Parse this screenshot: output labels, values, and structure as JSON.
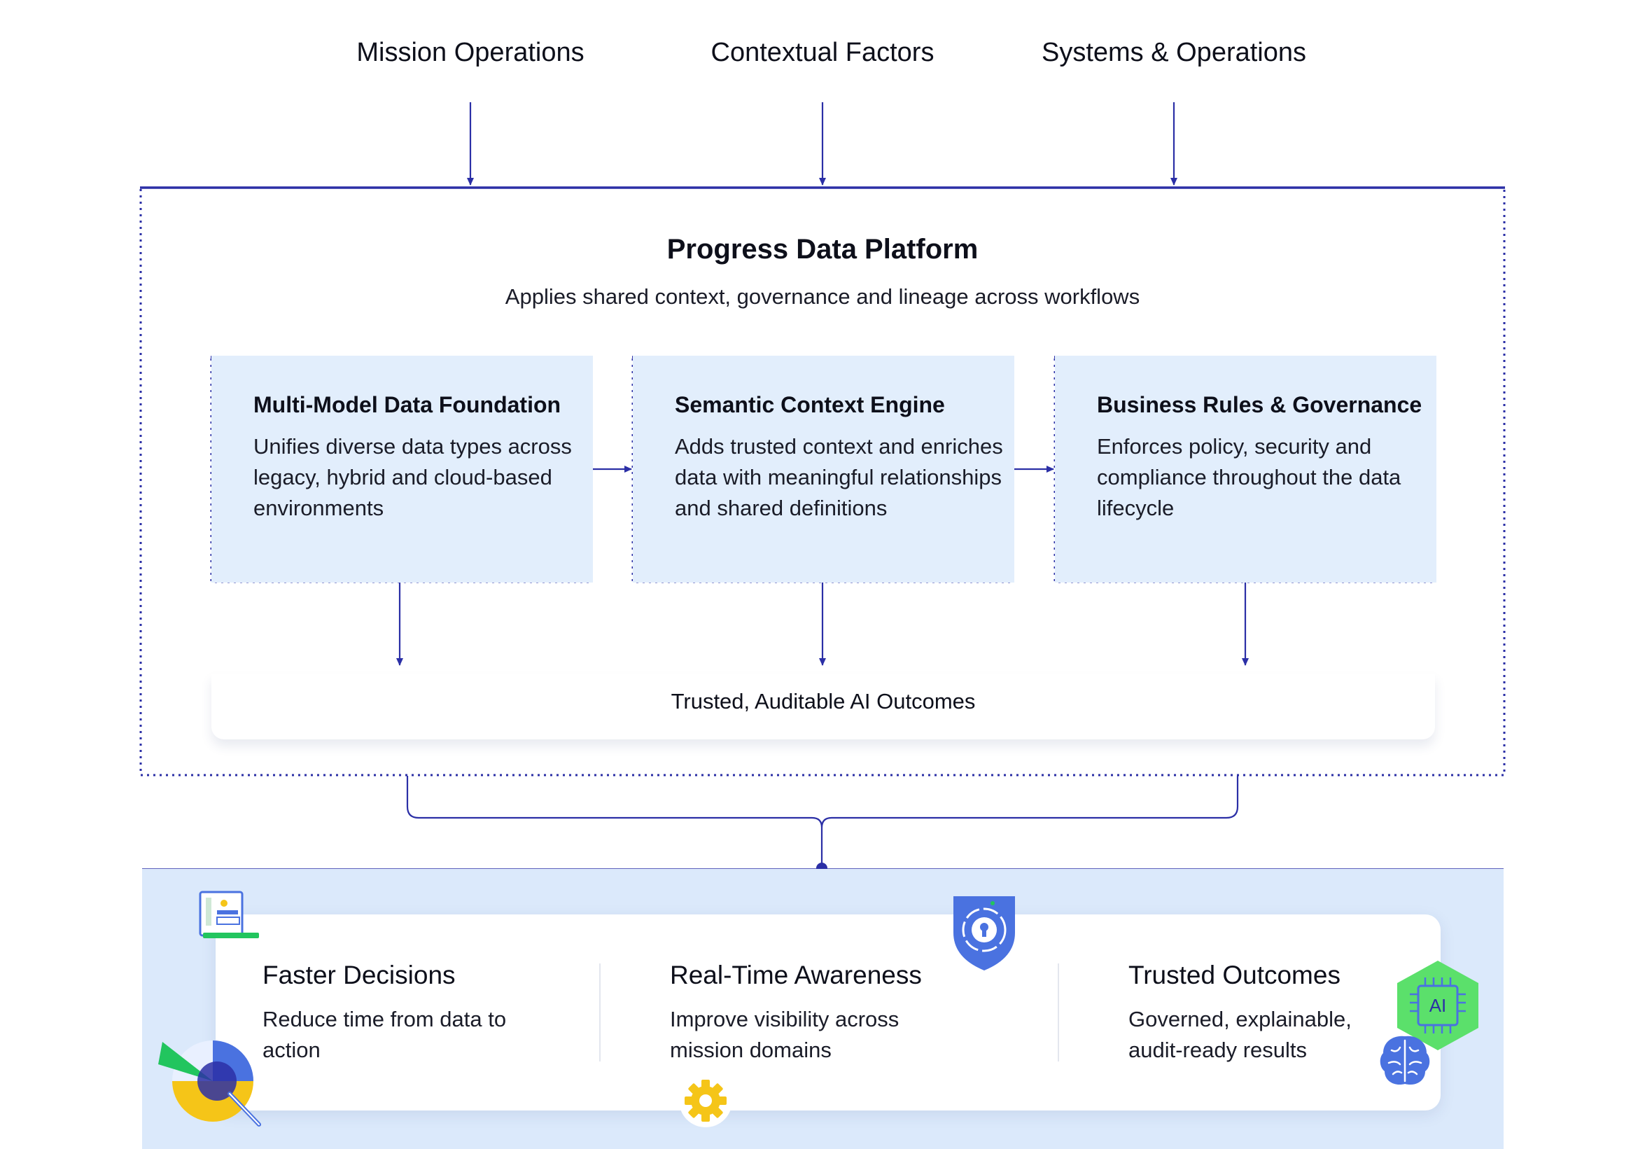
{
  "inputs": [
    {
      "label": "Mission Operations"
    },
    {
      "label": "Contextual Factors"
    },
    {
      "label": "Systems & Operations"
    }
  ],
  "platform": {
    "title": "Progress Data Platform",
    "subtitle": "Applies shared context, governance and lineage across workflows"
  },
  "cards": [
    {
      "title": "Multi-Model Data Foundation",
      "description": "Unifies diverse data types across legacy, hybrid and cloud-based environments"
    },
    {
      "title": "Semantic Context Engine",
      "description": "Adds trusted context and enriches data with meaningful relationships and shared definitions"
    },
    {
      "title": "Business Rules & Governance",
      "description": "Enforces policy, security and compliance throughout the data lifecycle"
    }
  ],
  "outcome": {
    "label": "Trusted, Auditable AI Outcomes"
  },
  "benefits": [
    {
      "title": "Faster Decisions",
      "description": "Reduce time from data to action"
    },
    {
      "title": "Real-Time Awareness",
      "description": "Improve visibility across mission domains"
    },
    {
      "title": "Trusted Outcomes",
      "description": "Governed, explainable, audit-ready results"
    }
  ],
  "icons": {
    "chip_label": "AI",
    "names": [
      "profile-document-icon",
      "pie-magnifier-icon",
      "lock-shield-icon",
      "gear-icon",
      "ai-chip-icon",
      "brain-icon"
    ]
  },
  "colors": {
    "navy": "#2b2fa6",
    "card_fill": "#e2eefc",
    "band_fill": "#dbe9fb",
    "green": "#22c55e",
    "yellow": "#f5c518",
    "blue": "#4a72e0"
  }
}
